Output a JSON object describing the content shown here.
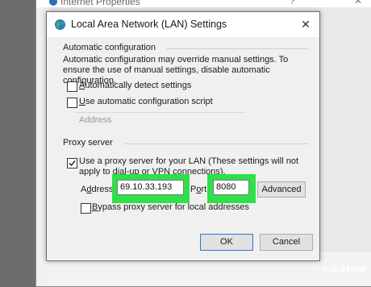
{
  "background_window": {
    "title": "Internet Properties",
    "help_glyph": "?",
    "close_glyph": "✕"
  },
  "dialog": {
    "title": "Local Area Network (LAN) Settings",
    "close_glyph": "✕",
    "auto_config": {
      "group_label": "Automatic configuration",
      "description": "Automatic configuration may override manual settings.  To ensure the use of manual settings, disable automatic configuration.",
      "detect_settings": {
        "label": "Automatically detect settings",
        "checked": false
      },
      "use_script": {
        "label": "Use automatic configuration script",
        "checked": false
      },
      "address_label": "Address"
    },
    "proxy": {
      "group_label": "Proxy server",
      "use_proxy": {
        "label": "Use a proxy server for your LAN (These settings will not apply to dial-up or VPN connections).",
        "checked": true
      },
      "address_label": "Address:",
      "address_value": "69.10.33.193",
      "port_label": "Port:",
      "port_value": "8080",
      "advanced_label": "Advanced",
      "bypass": {
        "label": "Bypass proxy server for local addresses",
        "checked": false
      }
    },
    "ok_label": "OK",
    "cancel_label": "Cancel"
  },
  "highlight_color": "#2ee04a",
  "watermark": {
    "prefix": "wiki",
    "suffix": "How"
  }
}
